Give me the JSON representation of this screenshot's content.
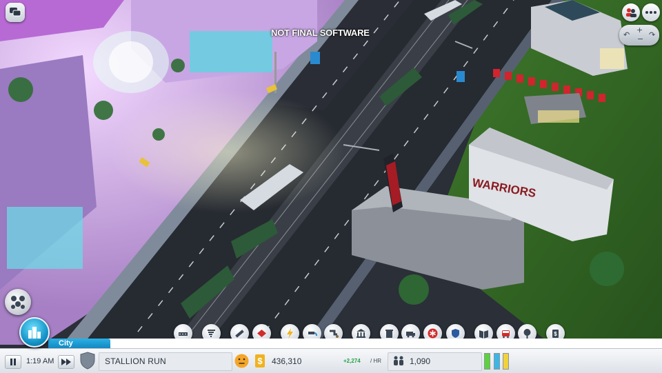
{
  "watermark": "NOT FINAL SOFTWARE",
  "building_sign": "WARRIORS",
  "city_tab": {
    "label": "City"
  },
  "toolbar": {
    "tools": [
      "roads",
      "zones",
      "utilities",
      "power",
      "water",
      "sewage",
      "government",
      "garbage",
      "fire",
      "health",
      "police",
      "education",
      "transportation",
      "parks",
      "tourism",
      "trade"
    ]
  },
  "status": {
    "time": "1:19 AM",
    "city_name": "STALLION RUN",
    "funds": "436,310",
    "income_rate": "+2,274",
    "income_unit": "/ HR",
    "population": "1,090",
    "demand": {
      "residential_color": "#5cd23d",
      "commercial_color": "#3bb7e6",
      "industrial_color": "#f0d23c"
    }
  },
  "colors": {
    "accent": "#1f9ad6",
    "glow": "#e8c7ff"
  }
}
